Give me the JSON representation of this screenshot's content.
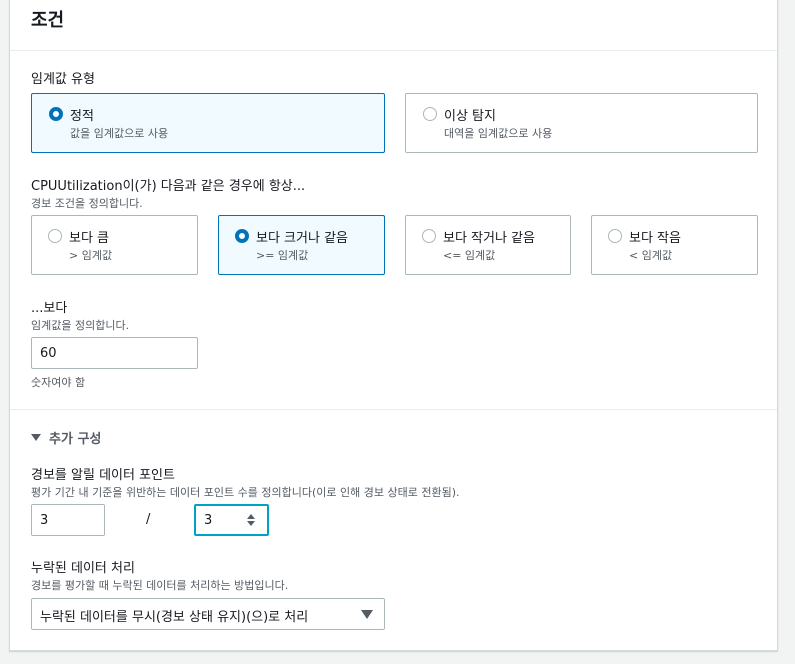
{
  "section": {
    "title": "조건"
  },
  "threshold_type": {
    "label": "임계값 유형",
    "options": [
      {
        "title": "정적",
        "desc": "값을 임계값으로 사용",
        "selected": true
      },
      {
        "title": "이상 탐지",
        "desc": "대역을 임계값으로 사용",
        "selected": false
      }
    ]
  },
  "condition": {
    "label": "CPUUtilization이(가) 다음과 같은 경우에 항상...",
    "desc": "경보 조건을 정의합니다.",
    "options": [
      {
        "title": "보다 큼",
        "desc": "> 임계값",
        "selected": false
      },
      {
        "title": "보다 크거나 같음",
        "desc": ">= 임계값",
        "selected": true
      },
      {
        "title": "보다 작거나 같음",
        "desc": "<= 임계값",
        "selected": false
      },
      {
        "title": "보다 작음",
        "desc": "< 임계값",
        "selected": false
      }
    ]
  },
  "threshold_value": {
    "label": "...보다",
    "desc": "임계값을 정의합니다.",
    "value": "60",
    "hint": "숫자여야 함"
  },
  "additional": {
    "toggle_label": "추가 구성",
    "datapoints": {
      "label": "경보를 알릴 데이터 포인트",
      "desc": "평가 기간 내 기준을 위반하는 데이터 포인트 수를 정의합니다(이로 인해 경보 상태로 전환됨).",
      "value_a": "3",
      "separator": "/",
      "value_b": "3"
    },
    "missing_data": {
      "label": "누락된 데이터 처리",
      "desc": "경보를 평가할 때 누락된 데이터를 처리하는 방법입니다.",
      "selected": "누락된 데이터를 무시(경보 상태 유지)(으)로 처리"
    }
  },
  "colors": {
    "accent": "#0073bb",
    "focus": "#00a1c9",
    "selected_bg": "#f1faff"
  }
}
